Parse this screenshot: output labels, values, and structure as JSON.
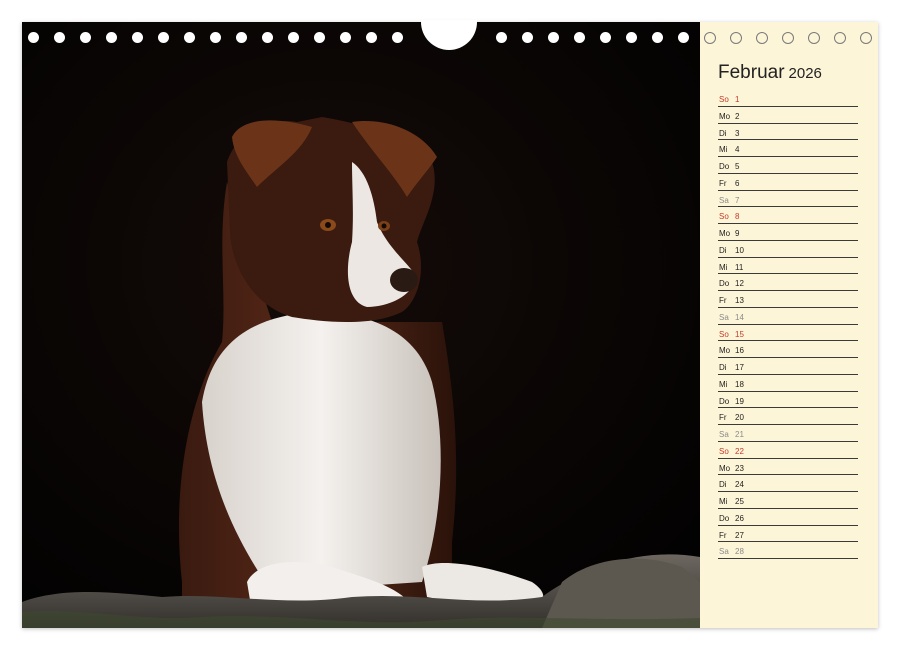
{
  "calendar": {
    "month": "Februar",
    "year": "2026",
    "days": [
      {
        "wd": "So",
        "d": "1",
        "type": "sun"
      },
      {
        "wd": "Mo",
        "d": "2",
        "type": "week"
      },
      {
        "wd": "Di",
        "d": "3",
        "type": "week"
      },
      {
        "wd": "Mi",
        "d": "4",
        "type": "week"
      },
      {
        "wd": "Do",
        "d": "5",
        "type": "week"
      },
      {
        "wd": "Fr",
        "d": "6",
        "type": "week"
      },
      {
        "wd": "Sa",
        "d": "7",
        "type": "sat"
      },
      {
        "wd": "So",
        "d": "8",
        "type": "sun"
      },
      {
        "wd": "Mo",
        "d": "9",
        "type": "week"
      },
      {
        "wd": "Di",
        "d": "10",
        "type": "week"
      },
      {
        "wd": "Mi",
        "d": "11",
        "type": "week"
      },
      {
        "wd": "Do",
        "d": "12",
        "type": "week"
      },
      {
        "wd": "Fr",
        "d": "13",
        "type": "week"
      },
      {
        "wd": "Sa",
        "d": "14",
        "type": "sat"
      },
      {
        "wd": "So",
        "d": "15",
        "type": "sun"
      },
      {
        "wd": "Mo",
        "d": "16",
        "type": "week"
      },
      {
        "wd": "Di",
        "d": "17",
        "type": "week"
      },
      {
        "wd": "Mi",
        "d": "18",
        "type": "week"
      },
      {
        "wd": "Do",
        "d": "19",
        "type": "week"
      },
      {
        "wd": "Fr",
        "d": "20",
        "type": "week"
      },
      {
        "wd": "Sa",
        "d": "21",
        "type": "sat"
      },
      {
        "wd": "So",
        "d": "22",
        "type": "sun"
      },
      {
        "wd": "Mo",
        "d": "23",
        "type": "week"
      },
      {
        "wd": "Di",
        "d": "24",
        "type": "week"
      },
      {
        "wd": "Mi",
        "d": "25",
        "type": "week"
      },
      {
        "wd": "Do",
        "d": "26",
        "type": "week"
      },
      {
        "wd": "Fr",
        "d": "27",
        "type": "week"
      },
      {
        "wd": "Sa",
        "d": "28",
        "type": "sat"
      }
    ]
  },
  "colors": {
    "sunday": "#c43a2a",
    "saturday": "#8a8a8a",
    "panel": "#fdf5d8",
    "photo_background": "#050303"
  }
}
